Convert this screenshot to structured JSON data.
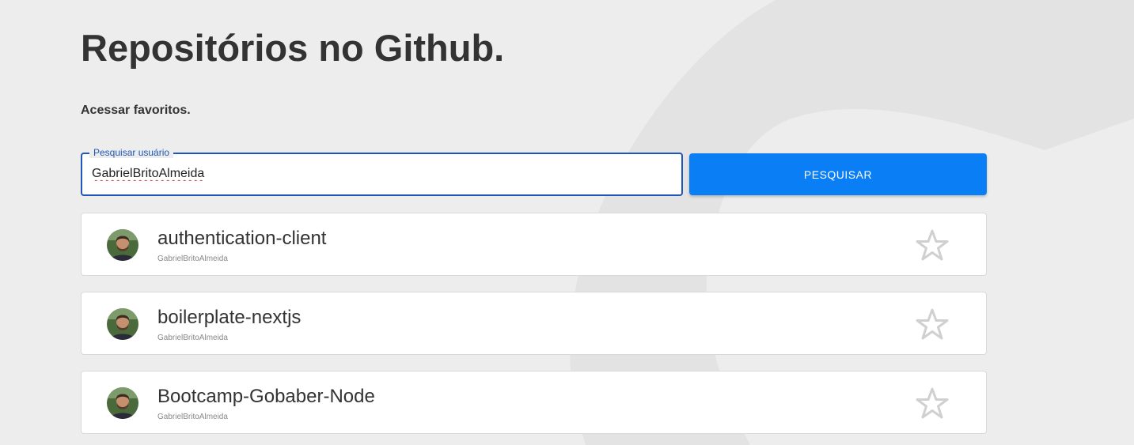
{
  "page": {
    "title": "Repositórios no Github.",
    "favorites_link": "Acessar favoritos."
  },
  "search": {
    "legend": "Pesquisar usuário",
    "value": "GabrielBritoAlmeida",
    "button_label": "PESQUISAR"
  },
  "repos": [
    {
      "name": "authentication-client",
      "owner": "GabrielBritoAlmeida",
      "favorite": false
    },
    {
      "name": "boilerplate-nextjs",
      "owner": "GabrielBritoAlmeida",
      "favorite": false
    },
    {
      "name": "Bootcamp-Gobaber-Node",
      "owner": "GabrielBritoAlmeida",
      "favorite": false
    }
  ],
  "icons": {
    "star": "star-outline-icon",
    "avatar": "user-avatar"
  },
  "colors": {
    "accent": "#0a7ff5",
    "field_border": "#1e57b8",
    "background": "#ededed",
    "star_outline": "#d0d0d0"
  }
}
